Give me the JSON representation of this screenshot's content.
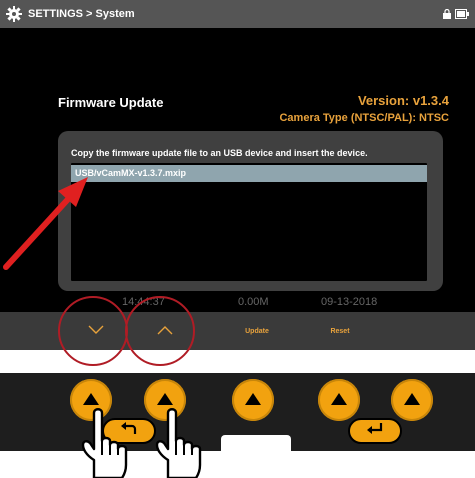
{
  "titlebar": {
    "text": "SETTINGS > System",
    "icon": "gear-icon"
  },
  "firmware": {
    "title": "Firmware Update",
    "version": "Version: v1.3.4",
    "camera_type": "Camera Type (NTSC/PAL): NTSC"
  },
  "dialog": {
    "message": "Copy the firmware update file to an USB device and insert the device.",
    "files": [
      "USB/vCamMX-v1.3.7.mxip"
    ],
    "selected_index": 0
  },
  "status": {
    "time": "14:44:37",
    "size": "0.00M",
    "date": "09-13-2018"
  },
  "softkeys": {
    "down": "chevron-down-icon",
    "up": "chevron-up-icon",
    "update": "Update",
    "reset": "Reset"
  },
  "colors": {
    "accent": "#f2a20f",
    "highlight": "#8fa5ae",
    "annotation": "#b01c25",
    "arrow": "#e02020"
  }
}
